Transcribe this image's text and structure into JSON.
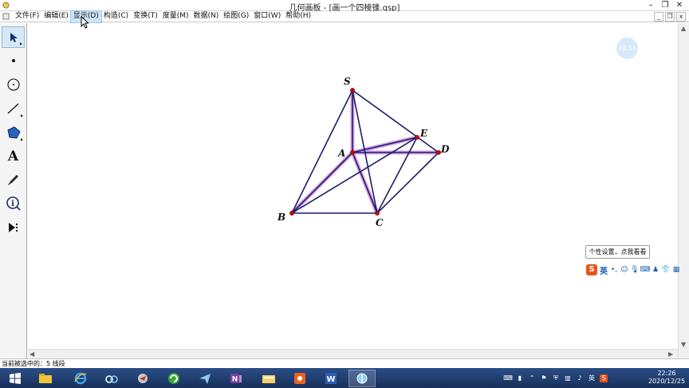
{
  "window": {
    "title": "几何画板 - [画一个四棱锥.gsp]",
    "buttons": {
      "minimize": "–",
      "maximize": "❐",
      "close": "✕"
    }
  },
  "menubar": {
    "items": [
      "文件(F)",
      "编辑(E)",
      "显示(D)",
      "构造(C)",
      "变换(T)",
      "度量(M)",
      "数据(N)",
      "绘图(G)",
      "窗口(W)",
      "帮助(H)"
    ],
    "active_index": 2,
    "doc_buttons": {
      "minimize": "_",
      "restore": "❐",
      "close": "x"
    }
  },
  "toolbox": {
    "tools": [
      {
        "name": "arrow-tool",
        "selected": true
      },
      {
        "name": "point-tool",
        "selected": false
      },
      {
        "name": "compass-tool",
        "selected": false
      },
      {
        "name": "straightedge-tool",
        "selected": false
      },
      {
        "name": "polygon-tool",
        "selected": false
      },
      {
        "name": "text-tool",
        "selected": false,
        "glyph": "A"
      },
      {
        "name": "marker-tool",
        "selected": false
      },
      {
        "name": "information-tool",
        "selected": false,
        "glyph": "i"
      },
      {
        "name": "custom-tool",
        "selected": false
      }
    ]
  },
  "canvas": {
    "float_badge": "00:13",
    "points": {
      "S": {
        "label": "S"
      },
      "A": {
        "label": "A"
      },
      "E": {
        "label": "E"
      },
      "D": {
        "label": "D"
      },
      "B": {
        "label": "B"
      },
      "C": {
        "label": "C"
      }
    },
    "selected_segments_count": 5,
    "colors": {
      "segment": "#1c1d6b",
      "selection": "#c678d8",
      "point": "#d40000"
    }
  },
  "ime": {
    "tooltip": "个性设置，点我看看",
    "logo": "S",
    "lang": "英"
  },
  "statusbar": {
    "text": "当前被选中的：5 线段"
  },
  "taskbar": {
    "apps": [
      "start-button",
      "file-explorer",
      "internet-explorer",
      "baidu-netdisk",
      "app-a",
      "360-browser",
      "feishu",
      "onenote",
      "folder",
      "recorder",
      "word",
      "geometer-sketchpad"
    ],
    "active_app": "geometer-sketchpad",
    "clock": {
      "time": "22:26",
      "date": "2020/12/25"
    }
  }
}
